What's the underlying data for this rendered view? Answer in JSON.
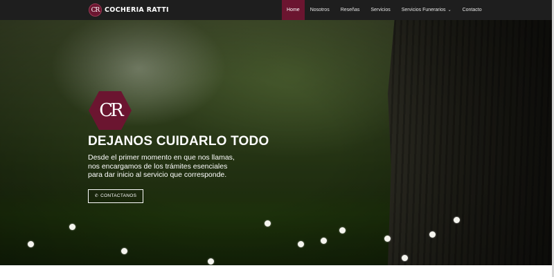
{
  "brand": {
    "logo_text": "CR",
    "name": "COCHERIA RATTI"
  },
  "nav": {
    "items": [
      {
        "label": "Home",
        "active": true
      },
      {
        "label": "Nosotros",
        "active": false
      },
      {
        "label": "Reseñas",
        "active": false
      },
      {
        "label": "Servicios",
        "active": false
      },
      {
        "label": "Servicios Funerarios",
        "active": false,
        "dropdown": true
      },
      {
        "label": "Contacto",
        "active": false
      }
    ]
  },
  "hero": {
    "logo_text": "CR",
    "title": "DEJANOS CUIDARLO TODO",
    "lines": [
      "Desde el primer momento en que nos llamas,",
      "nos encargamos de los trámites esenciales",
      "para dar inicio al servicio que corresponde."
    ],
    "cta_label": "CONTACTANOS",
    "cta_icon": "phone-icon"
  },
  "colors": {
    "brand": "#6b1530",
    "navbar": "#1e1e1e"
  }
}
